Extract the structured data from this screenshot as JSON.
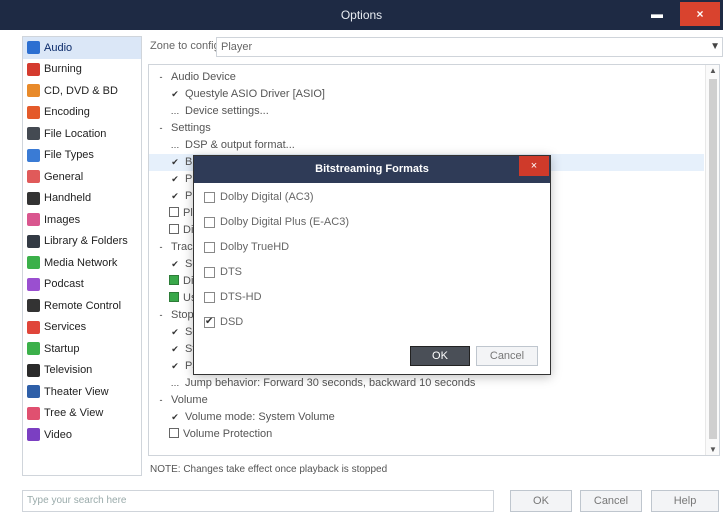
{
  "window": {
    "title": "Options",
    "minimize": "▬",
    "close": "×"
  },
  "sidebar": {
    "items": [
      {
        "label": "Audio",
        "color": "#2c6fd1"
      },
      {
        "label": "Burning",
        "color": "#d43b2f"
      },
      {
        "label": "CD, DVD & BD",
        "color": "#e88a2a"
      },
      {
        "label": "Encoding",
        "color": "#e45a2a"
      },
      {
        "label": "File Location",
        "color": "#444a52"
      },
      {
        "label": "File Types",
        "color": "#3a7bd5"
      },
      {
        "label": "General",
        "color": "#e05a5a"
      },
      {
        "label": "Handheld",
        "color": "#333333"
      },
      {
        "label": "Images",
        "color": "#d9568f"
      },
      {
        "label": "Library & Folders",
        "color": "#333a44"
      },
      {
        "label": "Media Network",
        "color": "#3bb04a"
      },
      {
        "label": "Podcast",
        "color": "#9a4fd0"
      },
      {
        "label": "Remote Control",
        "color": "#333333"
      },
      {
        "label": "Services",
        "color": "#e0453a"
      },
      {
        "label": "Startup",
        "color": "#3bb04a"
      },
      {
        "label": "Television",
        "color": "#2a2a2a"
      },
      {
        "label": "Theater View",
        "color": "#2e5fa8"
      },
      {
        "label": "Tree & View",
        "color": "#e05070"
      },
      {
        "label": "Video",
        "color": "#7b3fc2"
      }
    ]
  },
  "zone": {
    "label": "Zone to configure:",
    "value": "Player"
  },
  "tree": {
    "rows": [
      {
        "mark": "-",
        "text": "Audio Device",
        "indent": 0,
        "kind": "plain"
      },
      {
        "mark": "✔",
        "text": "Questyle ASIO Driver [ASIO]",
        "indent": 1,
        "kind": "plain"
      },
      {
        "mark": "…",
        "text": "Device settings...",
        "indent": 1,
        "kind": "plain"
      },
      {
        "mark": "-",
        "text": "Settings",
        "indent": 0,
        "kind": "plain"
      },
      {
        "mark": "…",
        "text": "DSP & output format...",
        "indent": 1,
        "kind": "plain"
      },
      {
        "mark": "✔",
        "text": "Bi",
        "indent": 1,
        "kind": "highlight"
      },
      {
        "mark": "✔",
        "text": "Pr",
        "indent": 1,
        "kind": "plain"
      },
      {
        "mark": "✔",
        "text": "Pl",
        "indent": 1,
        "kind": "plain"
      },
      {
        "mark": "",
        "text": "Pl",
        "indent": 1,
        "kind": "cb"
      },
      {
        "mark": "",
        "text": "Di",
        "indent": 1,
        "kind": "cb"
      },
      {
        "mark": "-",
        "text": "Track",
        "indent": 0,
        "kind": "plain"
      },
      {
        "mark": "✔",
        "text": "Se",
        "indent": 1,
        "kind": "plain"
      },
      {
        "mark": "",
        "text": "Di",
        "indent": 1,
        "kind": "cbgreen"
      },
      {
        "mark": "",
        "text": "Us",
        "indent": 1,
        "kind": "cbgreen"
      },
      {
        "mark": "-",
        "text": "Stop",
        "indent": 0,
        "kind": "plain"
      },
      {
        "mark": "✔",
        "text": "Se",
        "indent": 1,
        "kind": "plain"
      },
      {
        "mark": "✔",
        "text": "St",
        "indent": 1,
        "kind": "plain"
      },
      {
        "mark": "✔",
        "text": "Pause: Fade (fast)",
        "indent": 1,
        "kind": "plain"
      },
      {
        "mark": "…",
        "text": "Jump behavior: Forward 30 seconds, backward 10 seconds",
        "indent": 1,
        "kind": "plain"
      },
      {
        "mark": "-",
        "text": "Volume",
        "indent": 0,
        "kind": "plain"
      },
      {
        "mark": "✔",
        "text": "Volume mode: System Volume",
        "indent": 1,
        "kind": "plain"
      },
      {
        "mark": "",
        "text": "Volume Protection",
        "indent": 1,
        "kind": "cb"
      }
    ]
  },
  "note": "NOTE: Changes take effect once playback is stopped",
  "search": {
    "placeholder": "Type your search here"
  },
  "buttons": {
    "ok": "OK",
    "cancel": "Cancel",
    "help": "Help"
  },
  "dialog": {
    "title": "Bitstreaming Formats",
    "close": "×",
    "formats": [
      {
        "label": "Dolby Digital (AC3)",
        "checked": false
      },
      {
        "label": "Dolby Digital Plus (E-AC3)",
        "checked": false
      },
      {
        "label": "Dolby TrueHD",
        "checked": false
      },
      {
        "label": "DTS",
        "checked": false
      },
      {
        "label": "DTS-HD",
        "checked": false
      },
      {
        "label": "DSD",
        "checked": true
      }
    ],
    "ok": "OK",
    "cancel": "Cancel"
  }
}
